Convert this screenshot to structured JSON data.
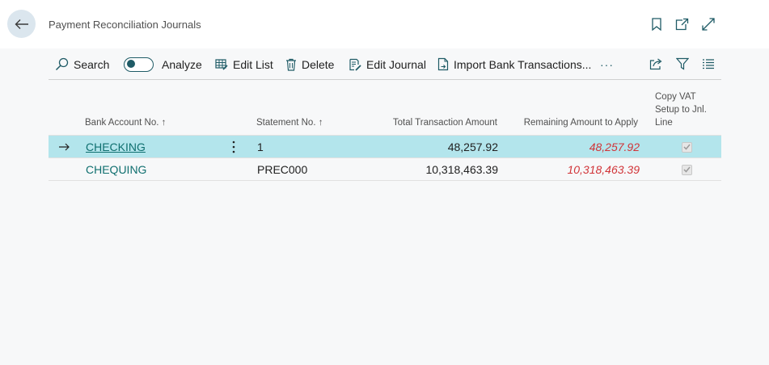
{
  "header": {
    "title": "Payment Reconciliation Journals"
  },
  "toolbar": {
    "search_label": "Search",
    "analyze_label": "Analyze",
    "edit_list_label": "Edit List",
    "delete_label": "Delete",
    "edit_journal_label": "Edit Journal",
    "import_label": "Import Bank Transactions...",
    "more_label": "···"
  },
  "table": {
    "columns": {
      "bank_account": "Bank Account No. ↑",
      "statement": "Statement No. ↑",
      "total": "Total Transaction Amount",
      "remaining": "Remaining Amount to Apply",
      "copy_vat_1": "Copy VAT",
      "copy_vat_2": "Setup to Jnl.",
      "copy_vat_3": "Line"
    },
    "rows": [
      {
        "bank_account": "CHECKING",
        "statement": "1",
        "total": "48,257.92",
        "remaining": "48,257.92",
        "copy_vat": true
      },
      {
        "bank_account": "CHEQUING",
        "statement": "PREC000",
        "total": "10,318,463.39",
        "remaining": "10,318,463.39",
        "copy_vat": true
      }
    ]
  },
  "colors": {
    "accent": "#1f5b66",
    "selected_row": "#b3e5ec",
    "link": "#0f6f6f",
    "negative": "#d13438"
  },
  "icons": [
    "back-arrow-icon",
    "bookmark-icon",
    "open-new-window-icon",
    "expand-icon",
    "search-icon",
    "edit-list-icon",
    "delete-icon",
    "edit-journal-icon",
    "import-icon",
    "share-icon",
    "filter-icon",
    "list-view-icon",
    "row-arrow-icon",
    "row-menu-icon",
    "checkmark-icon"
  ]
}
